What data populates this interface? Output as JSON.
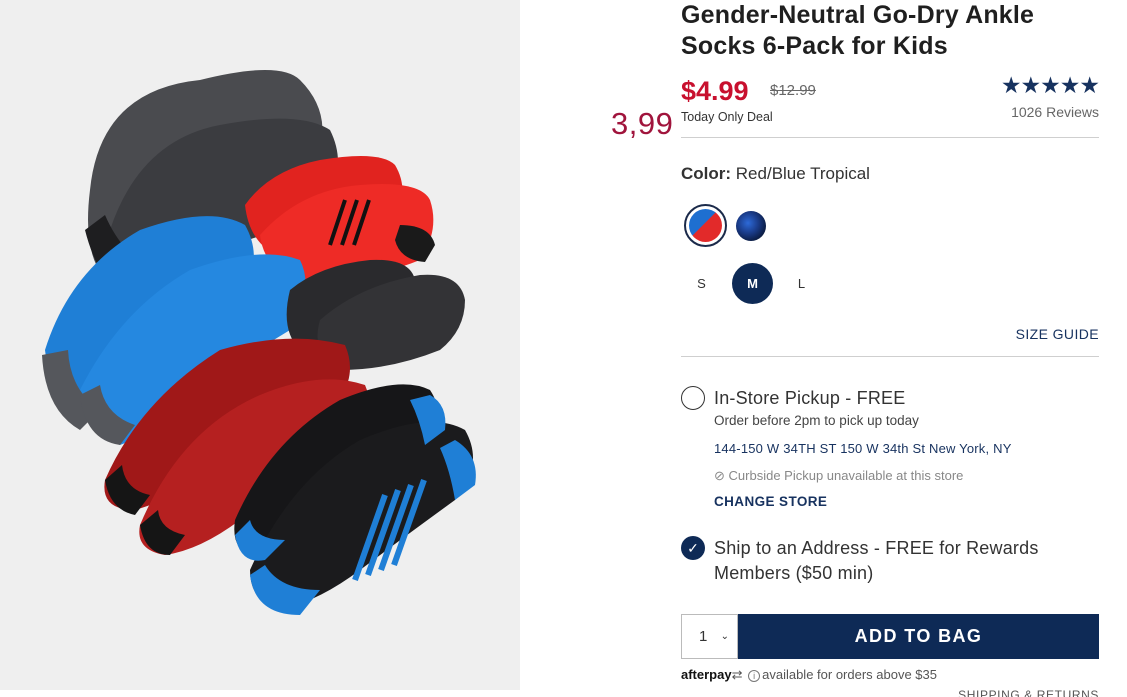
{
  "product": {
    "title": "Gender-Neutral Go-Dry Ankle Socks 6-Pack for Kids",
    "price": "$4.99",
    "original_price": "$12.99",
    "deal_label": "Today Only Deal",
    "stars": "★★★★★",
    "rating_fraction": 1.0,
    "reviews": "1026 Reviews"
  },
  "annotation": "3,99",
  "color": {
    "label": "Color:",
    "value": "Red/Blue Tropical"
  },
  "sizes": [
    "S",
    "M",
    "L"
  ],
  "selected_size": "M",
  "size_guide": "SIZE GUIDE",
  "pickup": {
    "title": "In-Store Pickup - FREE",
    "subtitle": "Order before 2pm to pick up today",
    "address": "144-150 W 34TH ST 150 W 34th St  New York, NY",
    "curbside": "Curbside Pickup unavailable at this store",
    "change_store": "CHANGE STORE"
  },
  "ship": {
    "title": "Ship to an Address - FREE for Rewards Members ($50 min)"
  },
  "quantity": "1",
  "add_to_bag": "ADD TO BAG",
  "afterpay": {
    "logo": "afterpay",
    "text": "available for orders above $35"
  },
  "shipping_returns": "SHIPPING & RETURNS",
  "colors": {
    "price_red": "#c8102e",
    "navy": "#0e2a56",
    "annotation": "#a0143c"
  }
}
